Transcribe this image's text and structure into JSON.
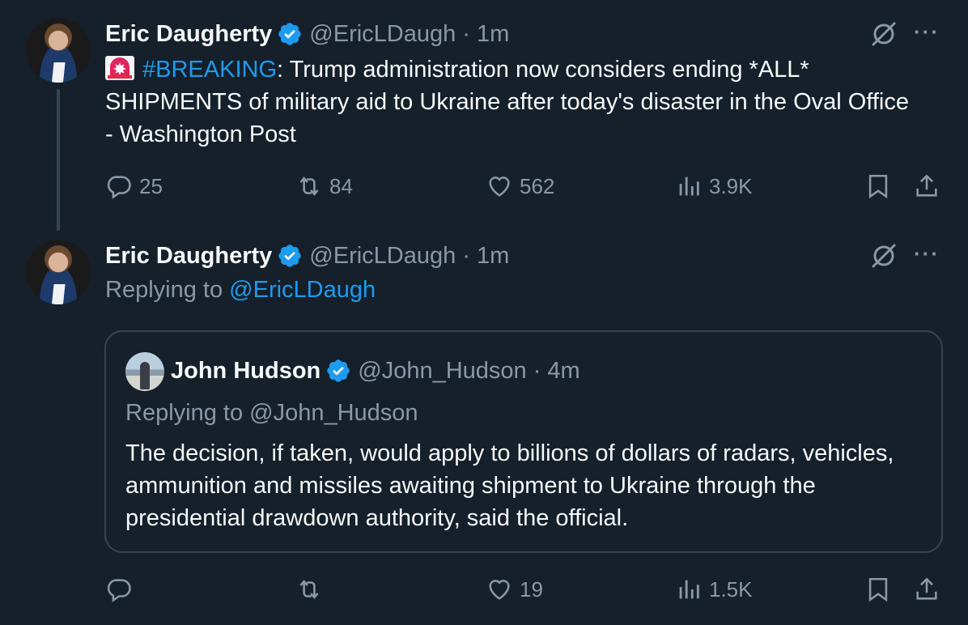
{
  "tweets": [
    {
      "name": "Eric Daugherty",
      "handle": "@EricLDaugh",
      "separator": "·",
      "time": "1m",
      "hashtag": "#BREAKING",
      "text_rest": ": Trump administration now considers ending *ALL* SHIPMENTS of military aid to Ukraine after today's disaster in the Oval Office - Washington Post",
      "stats": {
        "replies": "25",
        "retweets": "84",
        "likes": "562",
        "views": "3.9K"
      }
    },
    {
      "name": "Eric Daugherty",
      "handle": "@EricLDaugh",
      "separator": "·",
      "time": "1m",
      "replying_prefix": "Replying to ",
      "replying_to": "@EricLDaugh",
      "stats": {
        "replies": "",
        "retweets": "",
        "likes": "19",
        "views": "1.5K"
      }
    }
  ],
  "quote": {
    "name": "John Hudson",
    "handle": "@John_Hudson",
    "separator": "·",
    "time": "4m",
    "replying": "Replying to @John_Hudson",
    "text": "The decision, if taken, would apply to billions of dollars of radars, vehicles, ammunition and missiles awaiting shipment to Ukraine through the presidential drawdown authority, said the official."
  },
  "icons": {
    "verified": "verified-badge-icon",
    "grok": "grok-icon",
    "more": "more-icon",
    "reply": "reply-icon",
    "retweet": "retweet-icon",
    "like": "heart-icon",
    "views": "views-icon",
    "bookmark": "bookmark-icon",
    "share": "share-icon",
    "siren": "siren-emoji-icon"
  },
  "colors": {
    "background": "#15202b",
    "text": "#f7f9f9",
    "muted": "#8b98a5",
    "accent": "#1d9bf0",
    "border": "#38444d"
  }
}
